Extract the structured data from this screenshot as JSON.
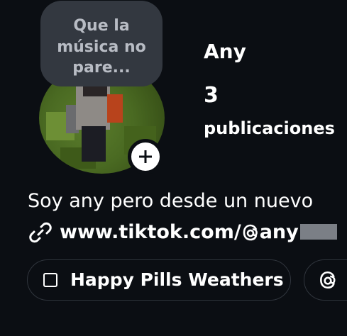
{
  "profile": {
    "username": "Any",
    "post_count": "3",
    "post_label": "publicaciones",
    "note": {
      "line1": "Que la",
      "line2": "música no",
      "line3": "pare..."
    },
    "bio": "Soy any pero desde un nuevo",
    "link": {
      "prefix": "www.tiktok.com/",
      "handle": "any",
      "icon": "link-icon"
    }
  },
  "highlights": [
    {
      "label": "Happy Pills Weathers",
      "icon": "checkbox-icon"
    },
    {
      "label": "",
      "icon": "threads-icon"
    }
  ],
  "colors": {
    "background": "#0b0e13",
    "note_bubble": "#333840",
    "note_text": "#b8bcc4",
    "chip_border": "#30353d"
  }
}
